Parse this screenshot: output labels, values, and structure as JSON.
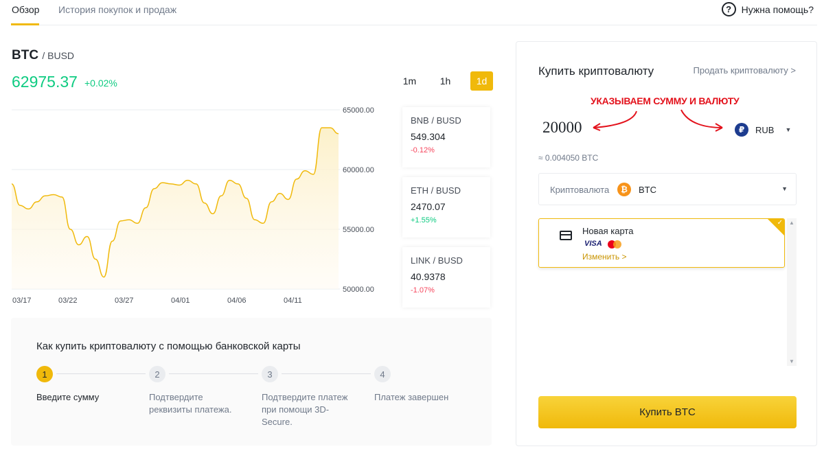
{
  "tabs": [
    {
      "label": "Обзор",
      "active": true
    },
    {
      "label": "История покупок и продаж",
      "active": false
    }
  ],
  "help": {
    "label": "Нужна помощь?",
    "icon": "help-circle-icon"
  },
  "pair": {
    "base": "BTC",
    "quote": "/ BUSD",
    "price": "62975.37",
    "change": "+0.02%"
  },
  "timeframes": [
    {
      "label": "1m",
      "active": false
    },
    {
      "label": "1h",
      "active": false
    },
    {
      "label": "1d",
      "active": true
    }
  ],
  "chart_data": {
    "type": "area",
    "title": "",
    "xlabel": "",
    "ylabel": "",
    "x_ticks": [
      "03/17",
      "03/22",
      "03/27",
      "04/01",
      "04/06",
      "04/11"
    ],
    "y_ticks": [
      "65000.00",
      "60000.00",
      "55000.00",
      "50000.00"
    ],
    "ylim": [
      50000,
      65000
    ],
    "grid": true,
    "series": [
      {
        "values": [
          58800,
          57000,
          56700,
          57300,
          57800,
          57900,
          57700,
          55000,
          53700,
          54400,
          52500,
          51000,
          54000,
          55700,
          55800,
          55500,
          56800,
          58400,
          58900,
          58800,
          58700,
          59100,
          58800,
          57200,
          56300,
          57800,
          59100,
          58800,
          57600,
          55800,
          55500,
          57300,
          58000,
          57500,
          59200,
          59900,
          59600,
          63500,
          63500,
          63000
        ]
      }
    ],
    "line_color": "#f0b90b"
  },
  "markets": [
    {
      "base": "BNB",
      "quote": "/ BUSD",
      "value": "549.304",
      "change": "-0.12%",
      "dir": "neg"
    },
    {
      "base": "ETH",
      "quote": "/ BUSD",
      "value": "2470.07",
      "change": "+1.55%",
      "dir": "pos"
    },
    {
      "base": "LINK",
      "quote": "/ BUSD",
      "value": "40.9378",
      "change": "-1.07%",
      "dir": "neg"
    }
  ],
  "howto": {
    "title": "Как купить криптовалюту с помощью банковской карты",
    "steps": [
      {
        "num": "1",
        "label": "Введите сумму",
        "active": true
      },
      {
        "num": "2",
        "label": "Подтвердите реквизиты платежа.",
        "active": false
      },
      {
        "num": "3",
        "label": "Подтвердите платеж при помощи 3D-Secure.",
        "active": false
      },
      {
        "num": "4",
        "label": "Платеж завершен",
        "active": false
      }
    ]
  },
  "buy": {
    "title": "Купить криптовалюту",
    "sell_link": "Продать криптовалюту >",
    "annotation": "УКАЗЫВАЕМ СУММУ И ВАЛЮТУ",
    "amount": "20000",
    "currency": "RUB",
    "currency_symbol": "₽",
    "approx": "≈ 0.004050 BTC",
    "crypto_label": "Криптовалюта",
    "crypto_code": "BTC",
    "crypto_symbol": "₿",
    "card_name": "Новая карта",
    "visa": "VISA",
    "change_link": "Изменить >",
    "button": "Купить BTC"
  }
}
